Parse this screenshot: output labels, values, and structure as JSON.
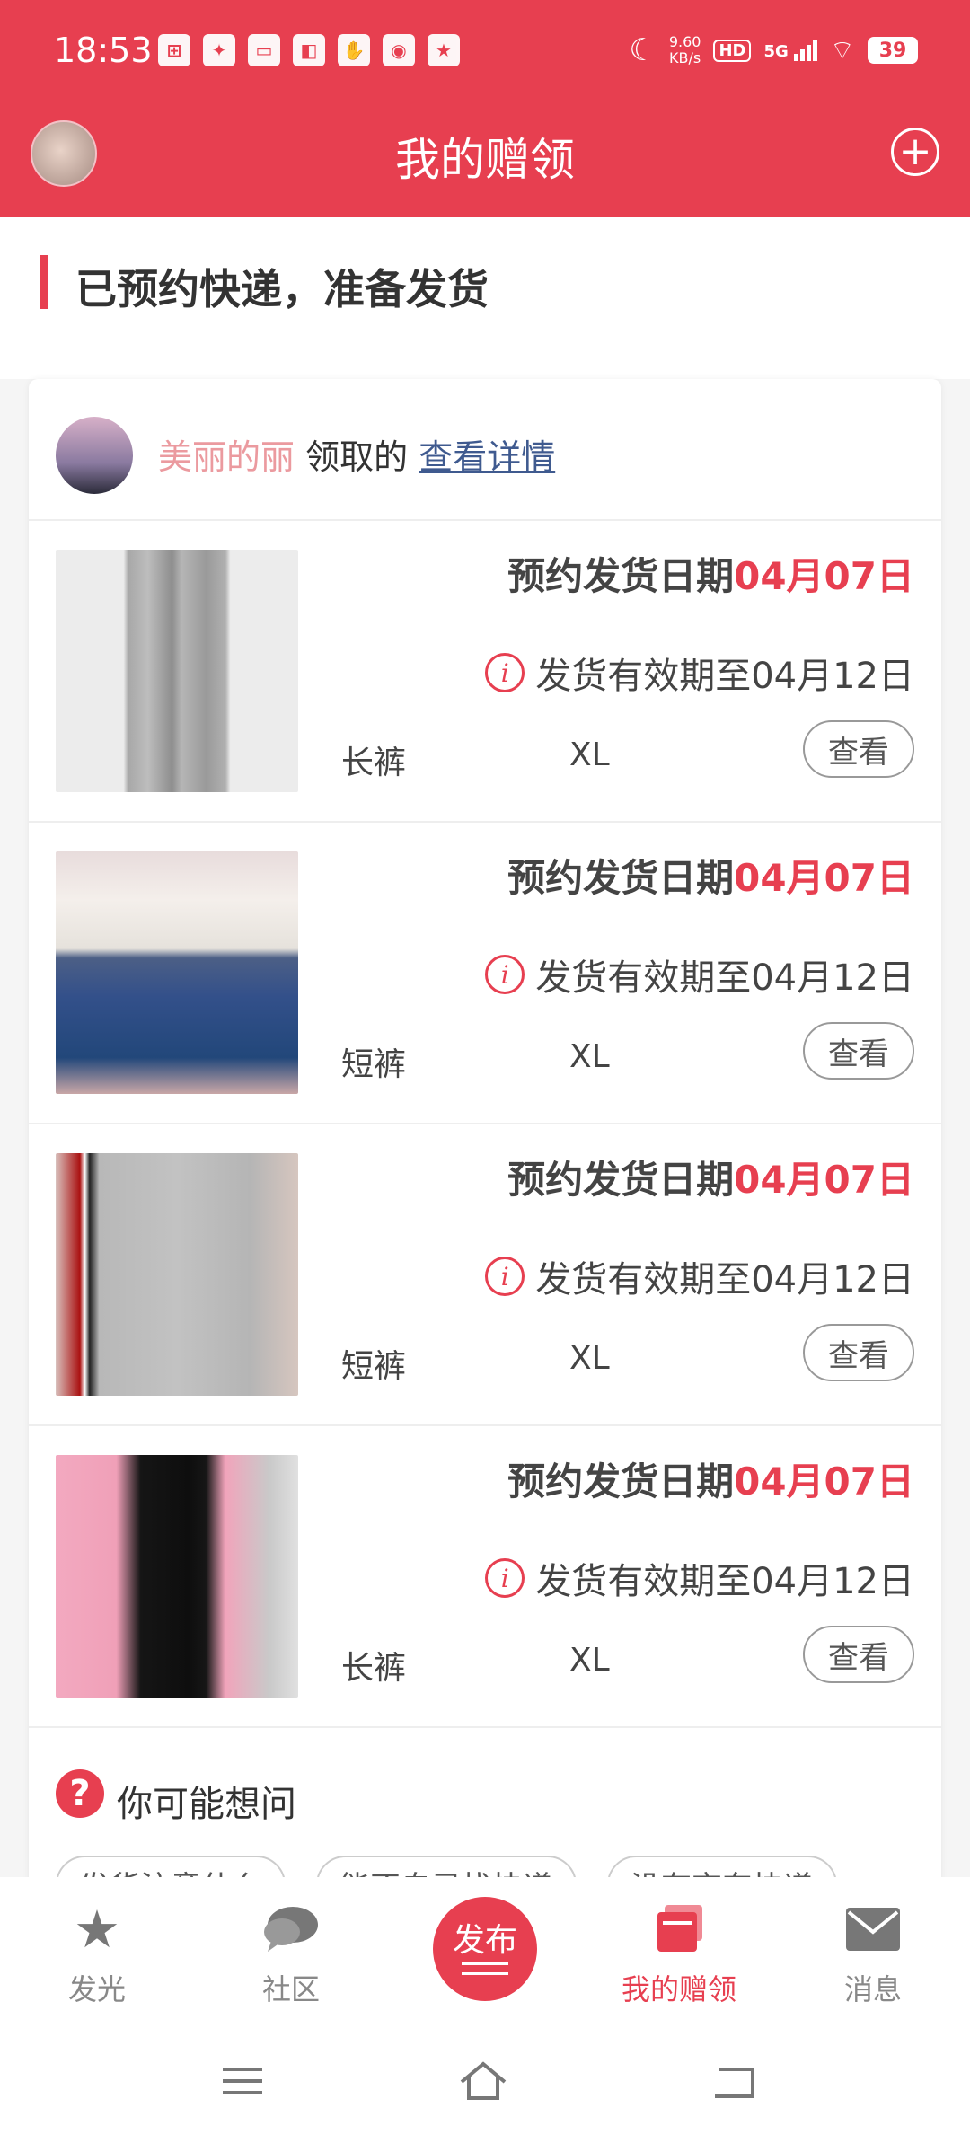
{
  "status_bar": {
    "time": "18:53",
    "net_speed": "9.60",
    "net_unit": "KB/s",
    "hd": "HD",
    "signal": "5G",
    "battery": "39"
  },
  "header": {
    "title": "我的赠领",
    "plus_label": "+"
  },
  "section": {
    "title": "已预约快递，准备发货"
  },
  "giver": {
    "name": "美丽的丽",
    "verb": " 领取的 ",
    "link": "查看详情"
  },
  "items": [
    {
      "ship_prefix": "预约发货日期",
      "ship_date": "04月07日",
      "valid": "发货有效期至04月12日",
      "category": "长裤",
      "size": "XL",
      "view": "查看"
    },
    {
      "ship_prefix": "预约发货日期",
      "ship_date": "04月07日",
      "valid": "发货有效期至04月12日",
      "category": "短裤",
      "size": "XL",
      "view": "查看"
    },
    {
      "ship_prefix": "预约发货日期",
      "ship_date": "04月07日",
      "valid": "发货有效期至04月12日",
      "category": "短裤",
      "size": "XL",
      "view": "查看"
    },
    {
      "ship_prefix": "预约发货日期",
      "ship_date": "04月07日",
      "valid": "发货有效期至04月12日",
      "category": "长裤",
      "size": "XL",
      "view": "查看"
    }
  ],
  "faq": {
    "title": "你可能想问",
    "chips": [
      "发货注意什么",
      "能不自己找快递",
      "没有京东快递"
    ]
  },
  "tabs": {
    "glow": "发光",
    "community": "社区",
    "publish": "发布",
    "mine": "我的赠领",
    "messages": "消息"
  },
  "colors": {
    "brand": "#e73f50",
    "name_pink": "#eb9a9f",
    "link_blue": "#3f5a8f"
  }
}
